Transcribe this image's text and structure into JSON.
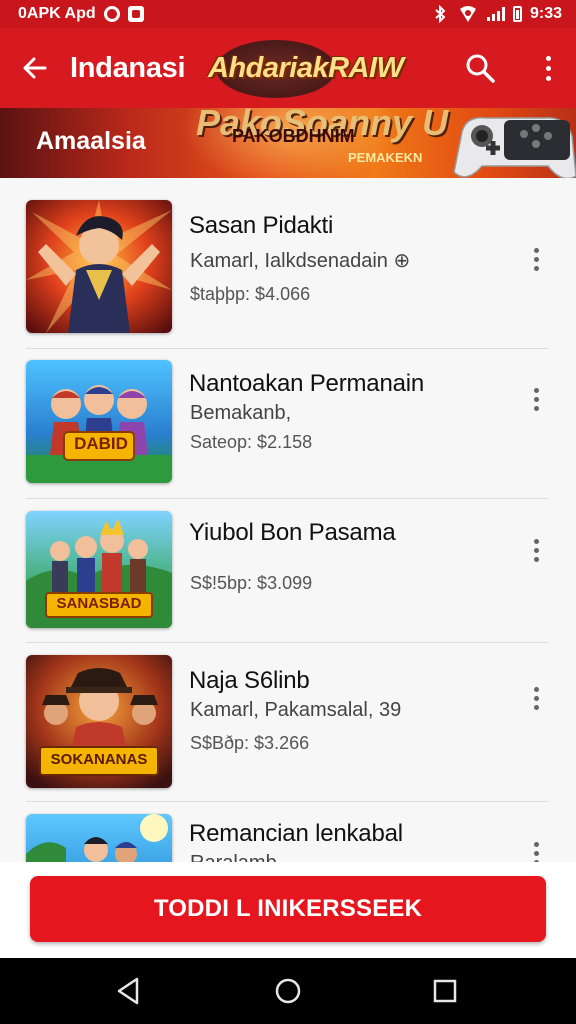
{
  "status_bar": {
    "left_text": "0APK Apd",
    "time": "9:33"
  },
  "app_bar": {
    "title": "Indanasi",
    "logo_text": "AhdariakRAIW",
    "back_icon": "arrow-back-icon",
    "search_icon": "search-icon",
    "menu_icon": "more-vert-icon"
  },
  "banner": {
    "label": "Amaalsia",
    "brand": "PakoSoanny U",
    "subtitle": "PAKOBDHNIM",
    "cta": "PEMAKEKN"
  },
  "games": [
    {
      "title": "Sasan Pidakti",
      "meta": "Kamarl, Ialkdsenadain ⊕",
      "price": "$taþþp: $4.066",
      "theme": "hero"
    },
    {
      "title": "Nantoakan Permanain",
      "meta": "Bemakanb,",
      "price": "Sateop: $2.158",
      "theme": "team",
      "thumb_label": "DABID"
    },
    {
      "title": "Yiubol Bon Pasama",
      "meta": "",
      "price": "S$!5bp: $3.099",
      "theme": "squad",
      "thumb_label": "SANASBAD"
    },
    {
      "title": "Naja S6linb",
      "meta": "Kamarl, Pakamsalal, 39",
      "price": "S$Bðp: $3.266",
      "theme": "pirate",
      "thumb_label": "SOKANANAS"
    },
    {
      "title": "Remancian lenkabal",
      "meta": "Raralamb",
      "price": "",
      "theme": "beach"
    }
  ],
  "action_button": {
    "label": "TODDI L INIKERSSEEK"
  },
  "colors": {
    "primary": "#d71920",
    "status": "#c9161c",
    "button": "#e5161d"
  },
  "nav_icons": [
    "back-triangle-icon",
    "home-circle-icon",
    "recents-square-icon"
  ]
}
